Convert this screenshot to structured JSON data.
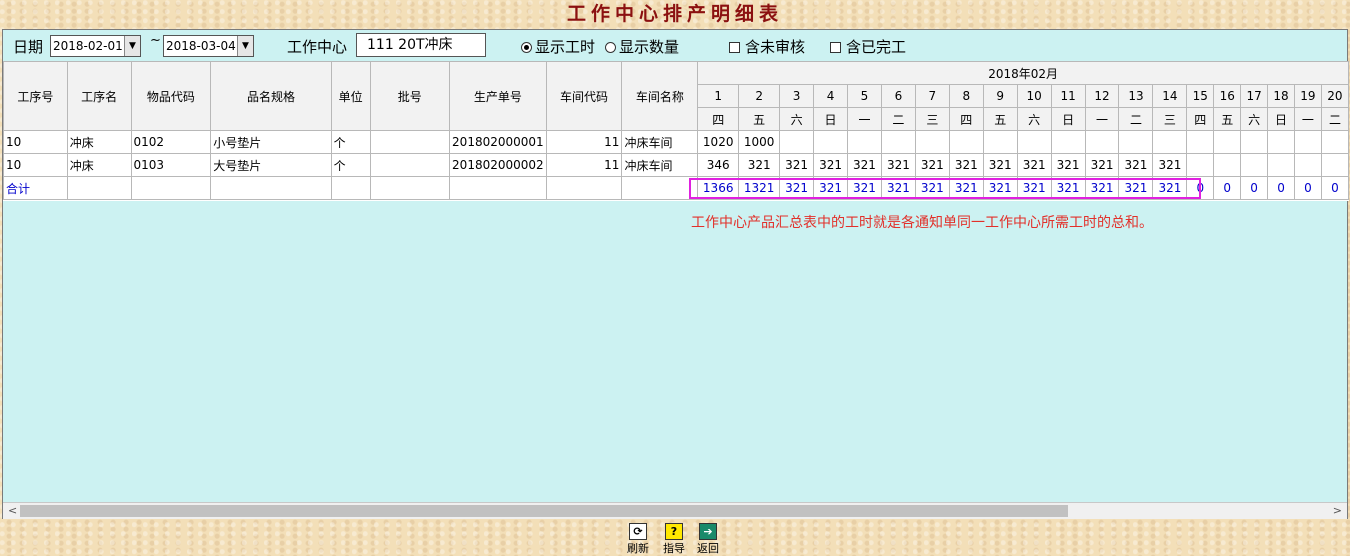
{
  "title": "工作中心排产明细表",
  "filter": {
    "date_label": "日期",
    "date_from": "2018-02-01",
    "tilde": "~",
    "date_to": "2018-03-04",
    "workcenter_label": "工作中心",
    "workcenter_value": "111 20T冲床",
    "opt_hours": "显示工时",
    "opt_qty": "显示数量",
    "opt_unreviewed": "含未审核",
    "opt_completed": "含已完工",
    "selected_option": "显示工时"
  },
  "table": {
    "columns": [
      "工序号",
      "工序名",
      "物品代码",
      "品名规格",
      "单位",
      "批号",
      "生产单号",
      "车间代码",
      "车间名称"
    ],
    "month_header": "2018年02月",
    "days": [
      "1",
      "2",
      "3",
      "4",
      "5",
      "6",
      "7",
      "8",
      "9",
      "10",
      "11",
      "12",
      "13",
      "14",
      "15",
      "16",
      "17",
      "18",
      "19",
      "20"
    ],
    "weekdays": [
      "四",
      "五",
      "六",
      "日",
      "一",
      "二",
      "三",
      "四",
      "五",
      "六",
      "日",
      "一",
      "二",
      "三",
      "四",
      "五",
      "六",
      "日",
      "一",
      "二"
    ],
    "rows": [
      {
        "cells": [
          "10",
          "冲床",
          "0102",
          "小号垫片",
          "个",
          "",
          "201802000001",
          "11",
          "冲床车间"
        ],
        "daily": [
          "1020",
          "1000",
          "",
          "",
          "",
          "",
          "",
          "",
          "",
          "",
          "",
          "",
          "",
          "",
          "",
          "",
          "",
          "",
          "",
          ""
        ]
      },
      {
        "cells": [
          "10",
          "冲床",
          "0103",
          "大号垫片",
          "个",
          "",
          "201802000002",
          "11",
          "冲床车间"
        ],
        "daily": [
          "346",
          "321",
          "321",
          "321",
          "321",
          "321",
          "321",
          "321",
          "321",
          "321",
          "321",
          "321",
          "321",
          "321",
          "",
          "",
          "",
          "",
          "",
          ""
        ]
      }
    ],
    "total": {
      "label": "合计",
      "daily": [
        "1366",
        "1321",
        "321",
        "321",
        "321",
        "321",
        "321",
        "321",
        "321",
        "321",
        "321",
        "321",
        "321",
        "321",
        "0",
        "0",
        "0",
        "0",
        "0",
        "0"
      ]
    }
  },
  "annotation": "工作中心产品汇总表中的工时就是各通知单同一工作中心所需工时的总和。",
  "scroll": {
    "left_arrow": "<",
    "right_arrow": ">"
  },
  "toolbar": {
    "refresh": "刷新",
    "guide": "指导",
    "back": "返回"
  }
}
